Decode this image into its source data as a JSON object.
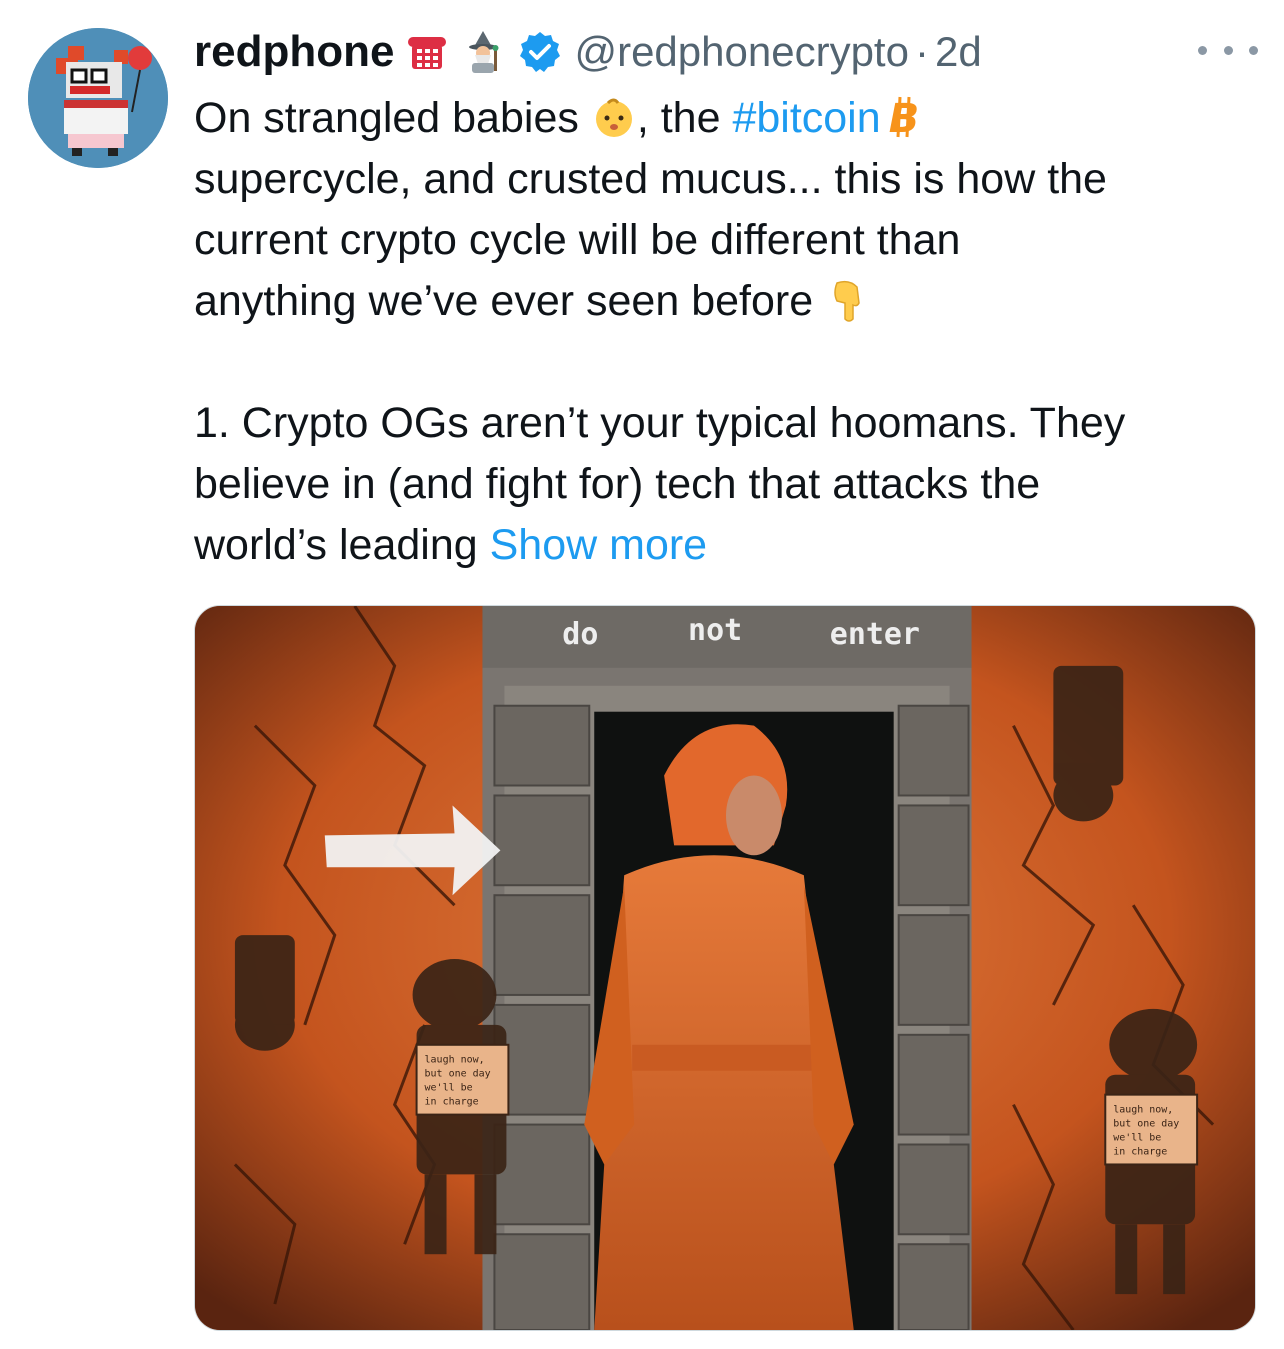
{
  "tweet": {
    "display_name": "redphone",
    "handle": "@redphonecrypto",
    "separator": "·",
    "time": "2d",
    "header_emojis": [
      "telephone-emoji",
      "mage-emoji"
    ],
    "lines": {
      "l1_a": "On strangled babies ",
      "l1_b": ", the ",
      "l1_hashtag": "#bitcoin",
      "l2": "supercycle, and crusted mucus... this is how the",
      "l3": "current crypto cycle will be different than",
      "l4": "anything we’ve ever seen before ",
      "l6": "1. Crypto OGs aren’t your typical hoomans. They",
      "l7": "believe in (and fight for) tech that attacks the",
      "l8": "world’s leading "
    },
    "show_more": "Show more"
  },
  "media": {
    "alt_icon": "tweet-image",
    "sign_words": [
      "do",
      "not",
      "enter"
    ],
    "stencil_text": [
      "laugh now,",
      "but one day",
      "we'll be",
      "in charge"
    ]
  },
  "colors": {
    "link": "#1d9bf0",
    "muted": "#536471",
    "verified": "#1d9bf0",
    "bitcoin": "#f7931a"
  }
}
